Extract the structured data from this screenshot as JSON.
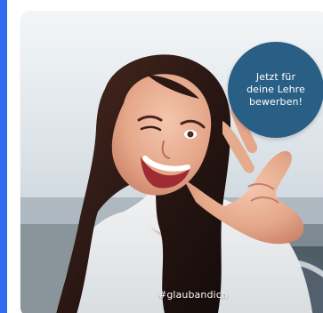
{
  "cta": {
    "label": "Jetzt für\ndeine Lehre\nbewerben!"
  },
  "photo": {
    "hashtag": "#glaubandich",
    "description_icon": "portrait-photo"
  },
  "colors": {
    "accent_bar": "#2f6df0",
    "badge": "#2a5f85",
    "text": "#ffffff"
  }
}
